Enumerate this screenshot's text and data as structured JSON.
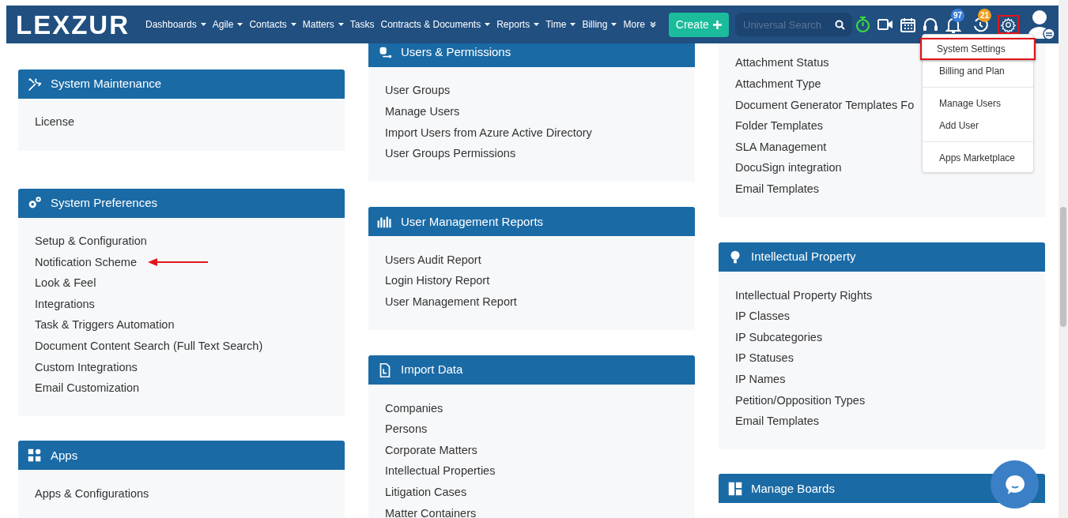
{
  "navbar": {
    "logo": "LEXZUR",
    "menu": [
      {
        "label": "Dashboards",
        "kind": "dropdown"
      },
      {
        "label": "Agile",
        "kind": "dropdown"
      },
      {
        "label": "Contacts",
        "kind": "dropdown"
      },
      {
        "label": "Matters",
        "kind": "dropdown"
      },
      {
        "label": "Tasks",
        "kind": "link"
      },
      {
        "label": "Contracts & Documents",
        "kind": "dropdown"
      },
      {
        "label": "Reports",
        "kind": "dropdown"
      },
      {
        "label": "Time",
        "kind": "dropdown"
      },
      {
        "label": "Billing",
        "kind": "dropdown"
      },
      {
        "label": "More",
        "kind": "more"
      }
    ],
    "create_button": "Create",
    "search": {
      "placeholder": "Universal Search"
    },
    "notification_badges": [
      {
        "count": "97",
        "color": "#3b7ddd"
      },
      {
        "count": "21",
        "color": "#f0a020"
      }
    ],
    "settings_highlighted": true
  },
  "settings_menu": {
    "groups": [
      [
        {
          "label": "System Settings",
          "highlighted": true
        },
        {
          "label": "Billing and Plan",
          "highlighted": false
        }
      ],
      [
        {
          "label": "Manage Users",
          "highlighted": false
        },
        {
          "label": "Add User",
          "highlighted": false
        }
      ],
      [
        {
          "label": "Apps Marketplace",
          "highlighted": false
        }
      ]
    ]
  },
  "columns": [
    [
      {
        "title": "System Maintenance",
        "items": [
          {
            "label": "License",
            "pointed": false
          }
        ]
      },
      {
        "title": "System Preferences",
        "items": [
          {
            "label": "Setup & Configuration",
            "pointed": false
          },
          {
            "label": "Notification Scheme",
            "pointed": true
          },
          {
            "label": "Look & Feel",
            "pointed": false
          },
          {
            "label": "Integrations",
            "pointed": false
          },
          {
            "label": "Task & Triggers Automation",
            "pointed": false
          },
          {
            "label": "Document Content Search (Full Text Search)",
            "pointed": false
          },
          {
            "label": "Custom Integrations",
            "pointed": false
          },
          {
            "label": "Email Customization",
            "pointed": false
          }
        ]
      },
      {
        "title": "Apps",
        "items": [
          {
            "label": "Apps & Configurations",
            "pointed": false
          }
        ]
      }
    ],
    [
      {
        "title": "Users & Permissions",
        "items": [
          {
            "label": "User Groups",
            "pointed": false
          },
          {
            "label": "Manage Users",
            "pointed": false
          },
          {
            "label": "Import Users from Azure Active Directory",
            "pointed": false
          },
          {
            "label": "User Groups Permissions",
            "pointed": false
          }
        ]
      },
      {
        "title": "User Management Reports",
        "items": [
          {
            "label": "Users Audit Report",
            "pointed": false
          },
          {
            "label": "Login History Report",
            "pointed": false
          },
          {
            "label": "User Management Report",
            "pointed": false
          }
        ]
      },
      {
        "title": "Import Data",
        "items": [
          {
            "label": "Companies",
            "pointed": false
          },
          {
            "label": "Persons",
            "pointed": false
          },
          {
            "label": "Corporate Matters",
            "pointed": false
          },
          {
            "label": "Intellectual Properties",
            "pointed": false
          },
          {
            "label": "Litigation Cases",
            "pointed": false
          },
          {
            "label": "Matter Containers",
            "pointed": false
          }
        ]
      }
    ],
    [
      {
        "items": [
          {
            "label": "Attachment Status"
          },
          {
            "label": "Attachment Type"
          },
          {
            "label": "Document Generator Templates Fo"
          },
          {
            "label": "Folder Templates"
          },
          {
            "label": "SLA Management"
          },
          {
            "label": "DocuSign integration"
          },
          {
            "label": "Email Templates"
          }
        ]
      },
      {
        "title": "Intellectual Property",
        "items": [
          {
            "label": "Intellectual Property Rights",
            "pointed": false
          },
          {
            "label": "IP Classes",
            "pointed": false
          },
          {
            "label": "IP Subcategories",
            "pointed": false
          },
          {
            "label": "IP Statuses",
            "pointed": false
          },
          {
            "label": "IP Names",
            "pointed": false
          },
          {
            "label": "Petition/Opposition Types",
            "pointed": false
          },
          {
            "label": "Email Templates",
            "pointed": false
          }
        ]
      },
      {
        "title": "Manage Boards"
      }
    ]
  ]
}
